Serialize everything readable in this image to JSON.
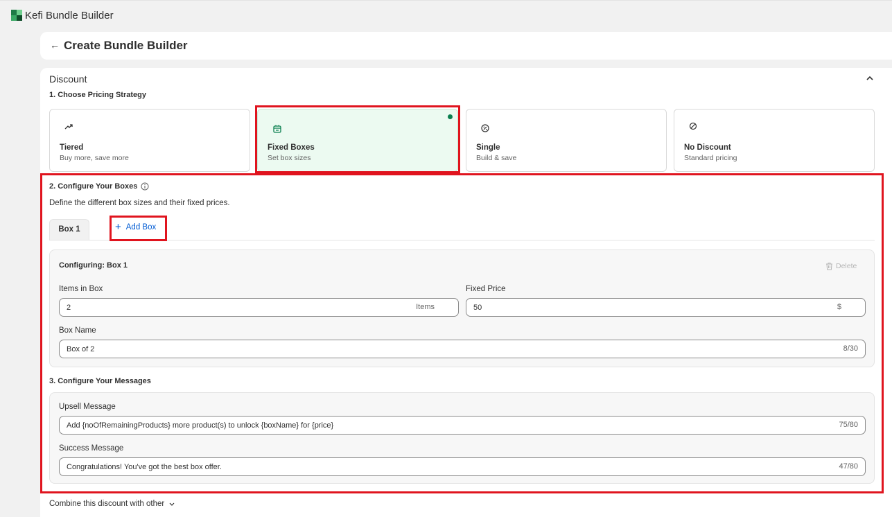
{
  "app": {
    "title": "Kefi Bundle Builder",
    "logo_icon": "app-logo-icon"
  },
  "header": {
    "title": "Create Bundle Builder",
    "back_icon": "arrow-left-icon"
  },
  "discount": {
    "section_title": "Discount",
    "step1_title": "1. Choose Pricing Strategy",
    "strategies": [
      {
        "name": "Tiered",
        "desc": "Buy more, save more",
        "icon": "trending-up-icon",
        "selected": false
      },
      {
        "name": "Fixed Boxes",
        "desc": "Set box sizes",
        "icon": "box-icon",
        "selected": true
      },
      {
        "name": "Single",
        "desc": "Build & save",
        "icon": "badge-icon",
        "selected": false
      },
      {
        "name": "No Discount",
        "desc": "Standard pricing",
        "icon": "slash-circle-icon",
        "selected": false
      }
    ],
    "step2_title": "2. Configure Your Boxes",
    "step2_desc": "Define the different box sizes and their fixed prices.",
    "tabs": [
      {
        "label": "Box 1"
      }
    ],
    "add_box_label": "Add Box",
    "config": {
      "title": "Configuring: Box 1",
      "delete_label": "Delete",
      "items_label": "Items in Box",
      "items_value": "2",
      "items_suffix": "Items",
      "price_label": "Fixed Price",
      "price_value": "50",
      "price_suffix": "$",
      "name_label": "Box Name",
      "name_value": "Box of 2",
      "name_counter": "8/30"
    },
    "step3_title": "3. Configure Your Messages",
    "messages": {
      "upsell_label": "Upsell Message",
      "upsell_value": "Add {noOfRemainingProducts} more product(s) to unlock {boxName} for {price}",
      "upsell_counter": "75/80",
      "success_label": "Success Message",
      "success_value": "Congratulations! You've got the best box offer.",
      "success_counter": "47/80"
    },
    "combine_label": "Combine this discount with other"
  },
  "colors": {
    "accent_green": "#0a7f4f",
    "selected_bg": "#ecfaf1",
    "link_blue": "#005bd3",
    "highlight_red": "#e0141e"
  }
}
